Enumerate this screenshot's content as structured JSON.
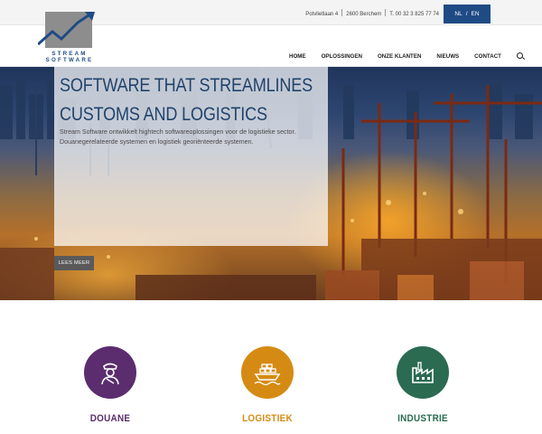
{
  "topbar": {
    "address": "Potvlietlaan 4",
    "city": "2600 Berchem",
    "phone": "T. 00 32 3 825 77 74",
    "lang_nl": "NL",
    "lang_sep": "/",
    "lang_en": "EN"
  },
  "logo": {
    "line1": "STREAM",
    "line2": "SOFTWARE"
  },
  "nav": {
    "items": [
      "HOME",
      "OPLOSSINGEN",
      "ONZE KLANTEN",
      "NIEUWS",
      "CONTACT"
    ],
    "search_icon": "search-icon"
  },
  "hero": {
    "title_line1": "SOFTWARE THAT STREAMLINES",
    "title_line2": "CUSTOMS AND LOGISTICS",
    "text_line1": "Stream Software ontwikkelt hightech softwareoplossingen voor de logistieke sector.",
    "text_line2": "Douanegerelateerde systemen en logistiek georiënteerde systemen.",
    "button": "LEES MEER"
  },
  "features": [
    {
      "label": "DOUANE",
      "icon": "customs-officer-icon",
      "color": "#5b2d6e"
    },
    {
      "label": "LOGISTIEK",
      "icon": "ship-icon",
      "color": "#d58b13"
    },
    {
      "label": "INDUSTRIE",
      "icon": "factory-icon",
      "color": "#2b6b52"
    }
  ],
  "colors": {
    "brand_blue": "#1f4b85",
    "title_blue": "#21436b"
  }
}
